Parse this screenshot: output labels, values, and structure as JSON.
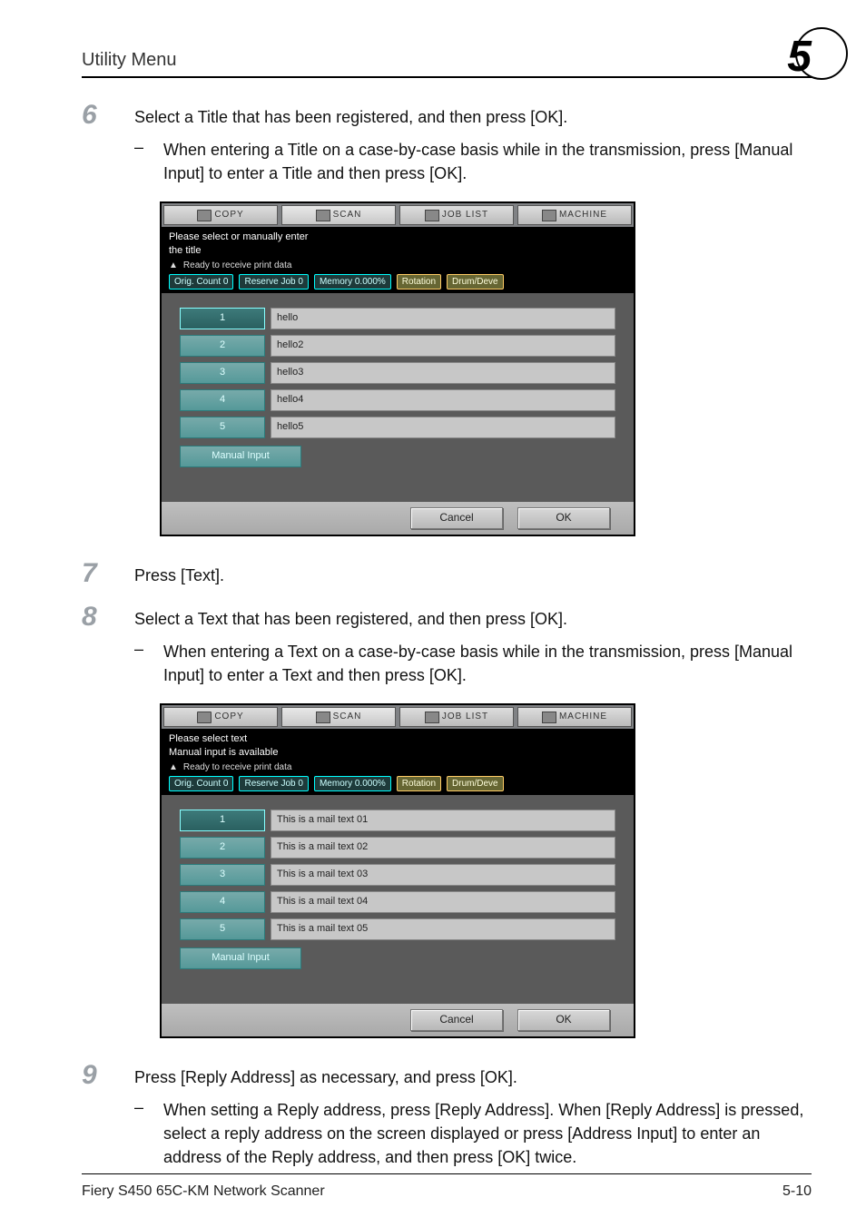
{
  "header": {
    "section_title": "Utility Menu",
    "chapter_number": "5"
  },
  "footer": {
    "product": "Fiery S450 65C-KM Network Scanner",
    "page": "5-10"
  },
  "step6": {
    "num": "6",
    "text": "Select a Title that has been registered, and then press [OK].",
    "dash": "–",
    "sub": "When entering a Title on a case-by-case basis while in the transmission, press [Manual Input] to enter a Title and then press [OK]."
  },
  "step7": {
    "num": "7",
    "text": "Press [Text]."
  },
  "step8": {
    "num": "8",
    "text": "Select a Text that has been registered, and then press [OK].",
    "dash": "–",
    "sub": "When entering a Text on a case-by-case basis while in the transmission, press [Manual Input] to enter a Text and then press [OK]."
  },
  "step9": {
    "num": "9",
    "text": "Press [Reply Address] as necessary, and press [OK].",
    "dash": "–",
    "sub": "When setting a Reply address, press [Reply Address]. When [Reply Address] is pressed, select a reply address on the screen displayed or press [Address Input] to enter an address of the Reply address, and then press [OK] twice."
  },
  "panel_common": {
    "tabs": {
      "copy": "COPY",
      "scan": "SCAN",
      "joblist": "JOB LIST",
      "machine": "MACHINE"
    },
    "status_ready": "Ready to receive print data",
    "status_row": {
      "orig": "Orig. Count",
      "orig_v": "0",
      "reserve": "Reserve Job",
      "reserve_v": "0",
      "memory": "Memory",
      "memory_v": "0.000%",
      "rotation": "Rotation",
      "drum": "Drum/Deve"
    },
    "manual_input": "Manual Input",
    "cancel": "Cancel",
    "ok": "OK"
  },
  "panel_title": {
    "prompt_l1": "Please select or manually enter",
    "prompt_l2": "the title",
    "rows": [
      {
        "n": "1",
        "v": "hello"
      },
      {
        "n": "2",
        "v": "hello2"
      },
      {
        "n": "3",
        "v": "hello3"
      },
      {
        "n": "4",
        "v": "hello4"
      },
      {
        "n": "5",
        "v": "hello5"
      }
    ]
  },
  "panel_text": {
    "prompt_l1": "Please select text",
    "prompt_l2": "Manual input is available",
    "rows": [
      {
        "n": "1",
        "v": "This is a mail text 01"
      },
      {
        "n": "2",
        "v": "This is a mail text 02"
      },
      {
        "n": "3",
        "v": "This is a mail text 03"
      },
      {
        "n": "4",
        "v": "This is a mail text 04"
      },
      {
        "n": "5",
        "v": "This is a mail text 05"
      }
    ]
  }
}
